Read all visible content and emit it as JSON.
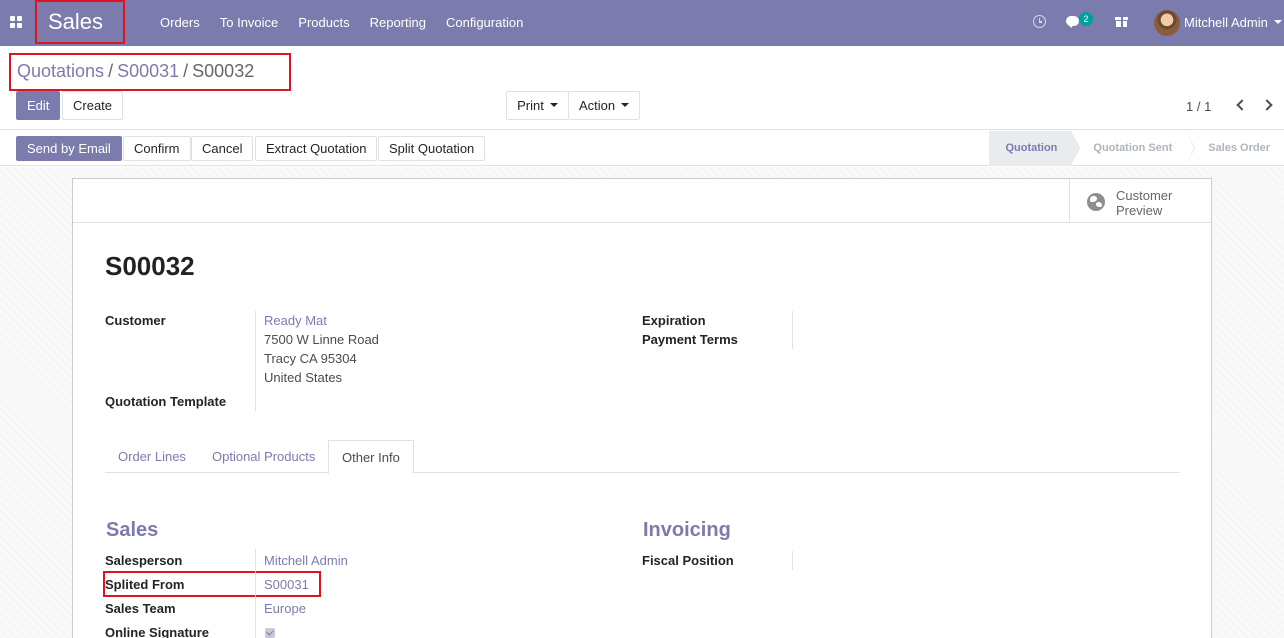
{
  "navbar": {
    "app_name": "Sales",
    "menu": [
      "Orders",
      "To Invoice",
      "Products",
      "Reporting",
      "Configuration"
    ],
    "messages_count": "2",
    "user_name": "Mitchell Admin",
    "color": "#7c7bad"
  },
  "breadcrumb": {
    "root": "Quotations",
    "parent": "S00031",
    "current": "S00032",
    "separator": "/"
  },
  "toolbar": {
    "edit_label": "Edit",
    "create_label": "Create",
    "print_label": "Print",
    "action_label": "Action",
    "pager": "1 / 1"
  },
  "header_buttons": {
    "send_by_email": "Send by Email",
    "confirm": "Confirm",
    "cancel": "Cancel",
    "extract_quotation": "Extract Quotation",
    "split_quotation": "Split Quotation"
  },
  "stages": [
    "Quotation",
    "Quotation Sent",
    "Sales Order"
  ],
  "current_stage": "Quotation",
  "sheet": {
    "preview_button": "Customer Preview",
    "record_name": "S00032",
    "customer_label": "Customer",
    "customer_name": "Ready Mat",
    "address_line1": "7500 W Linne Road",
    "address_line2": "Tracy CA 95304",
    "address_line3": "United States",
    "quotation_template_label": "Quotation Template",
    "expiration_label": "Expiration",
    "payment_terms_label": "Payment Terms",
    "tabs": [
      "Order Lines",
      "Optional Products",
      "Other Info"
    ],
    "active_tab": "Other Info",
    "sales_group": {
      "title": "Sales",
      "salesperson_label": "Salesperson",
      "salesperson_value": "Mitchell Admin",
      "splited_from_label": "Splited From",
      "splited_from_value": "S00031",
      "sales_team_label": "Sales Team",
      "sales_team_value": "Europe",
      "online_signature_label": "Online Signature",
      "online_signature_checked": true
    },
    "invoicing_group": {
      "title": "Invoicing",
      "fiscal_position_label": "Fiscal Position"
    }
  }
}
